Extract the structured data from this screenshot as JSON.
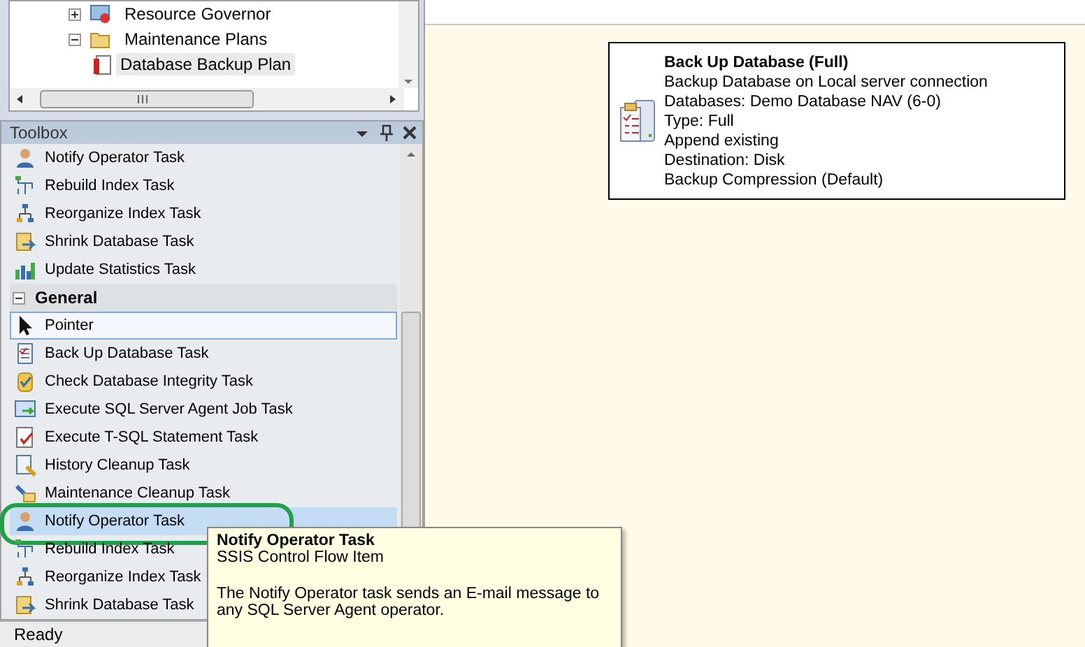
{
  "object_explorer": {
    "nodes": [
      {
        "label": "Resource Governor",
        "expanded": false
      },
      {
        "label": "Maintenance Plans",
        "expanded": true,
        "children": [
          {
            "label": "Database Backup Plan",
            "selected": true
          }
        ]
      }
    ]
  },
  "toolbox": {
    "title": "Toolbox",
    "items": [
      {
        "kind": "item",
        "label": "Notify Operator Task",
        "selected": false,
        "hovered": false
      },
      {
        "kind": "item",
        "label": "Rebuild Index Task",
        "selected": false,
        "hovered": false
      },
      {
        "kind": "item",
        "label": "Reorganize Index Task",
        "selected": false,
        "hovered": false
      },
      {
        "kind": "item",
        "label": "Shrink Database Task",
        "selected": false,
        "hovered": false
      },
      {
        "kind": "item",
        "label": "Update Statistics Task",
        "selected": false,
        "hovered": false
      },
      {
        "kind": "category",
        "label": "General",
        "expanded": true
      },
      {
        "kind": "item",
        "label": "Pointer",
        "selected": true,
        "hovered": false
      },
      {
        "kind": "item",
        "label": "Back Up Database Task",
        "selected": false,
        "hovered": false
      },
      {
        "kind": "item",
        "label": "Check Database Integrity Task",
        "selected": false,
        "hovered": false
      },
      {
        "kind": "item",
        "label": "Execute SQL Server Agent Job Task",
        "selected": false,
        "hovered": false
      },
      {
        "kind": "item",
        "label": "Execute T-SQL Statement Task",
        "selected": false,
        "hovered": false
      },
      {
        "kind": "item",
        "label": "History Cleanup Task",
        "selected": false,
        "hovered": false
      },
      {
        "kind": "item",
        "label": "Maintenance Cleanup Task",
        "selected": false,
        "hovered": false
      },
      {
        "kind": "item",
        "label": "Notify Operator Task",
        "selected": false,
        "hovered": true,
        "annotated": true
      },
      {
        "kind": "item",
        "label": "Rebuild Index Task",
        "selected": false,
        "hovered": false
      },
      {
        "kind": "item",
        "label": "Reorganize Index Task",
        "selected": false,
        "hovered": false
      },
      {
        "kind": "item",
        "label": "Shrink Database Task",
        "selected": false,
        "hovered": false
      }
    ]
  },
  "tooltip": {
    "title": "Notify Operator Task",
    "subtitle": "SSIS Control Flow Item",
    "description": "The Notify Operator task sends an E-mail message to any SQL Server Agent operator."
  },
  "status_bar": {
    "text": "Ready"
  },
  "designer": {
    "task": {
      "title": "Back Up Database (Full)",
      "lines": [
        "Backup Database on Local server connection",
        "Databases: Demo Database NAV (6-0)",
        "Type: Full",
        "Append existing",
        "Destination: Disk",
        "Backup Compression (Default)"
      ]
    }
  }
}
